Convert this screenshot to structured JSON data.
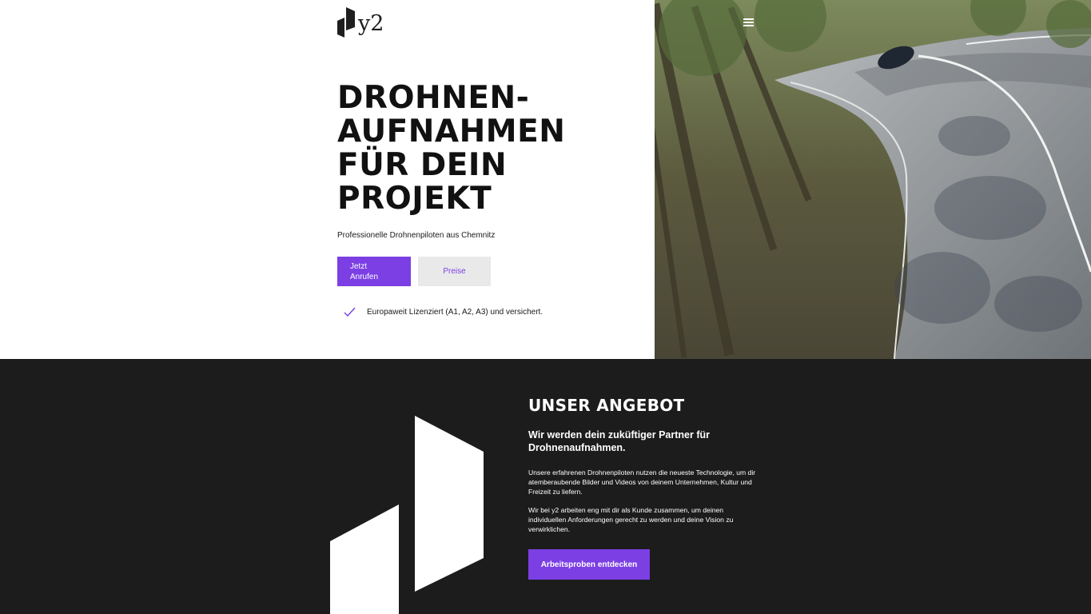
{
  "header": {
    "logo_text": "y2",
    "logo_icon": "y2-logo-mark",
    "menu_icon": "hamburger-menu-icon"
  },
  "hero": {
    "title_lines": [
      "DROHNEN-",
      "AUFNAHMEN",
      "FÜR DEIN",
      "PROJEKT"
    ],
    "subtitle": "Professionelle Drohnenpiloten aus Chemnitz",
    "primary_button_lines": [
      "Jetzt",
      "Anrufen"
    ],
    "secondary_button": "Preise",
    "license_icon": "checkmark-icon",
    "license_text": "Europaweit Lizenziert (A1, A2, A3) und versichert.",
    "media": "aerial drone video of a winding road through a forest with a car"
  },
  "offer": {
    "title": "UNSER ANGEBOT",
    "lead": "Wir werden dein zuküftiger Partner für Drohnenaufnahmen.",
    "paragraph_1": "Unsere erfahrenen Drohnenpiloten nutzen die neueste Technologie, um dir atemberaubende Bilder und Videos von deinem Unternehmen, Kultur und Freizeit zu liefern.",
    "paragraph_2": "Wir bei y2 arbeiten eng mit dir als Kunde zusammen, um deinen individuellen Anforderungen gerecht zu werden und deine Vision zu verwirklichen.",
    "button": "Arbeitsproben entdecken"
  },
  "colors": {
    "accent": "#7b3fe4",
    "dark_background": "#1c1c1c",
    "secondary_button_bg": "#e9e9e9"
  }
}
